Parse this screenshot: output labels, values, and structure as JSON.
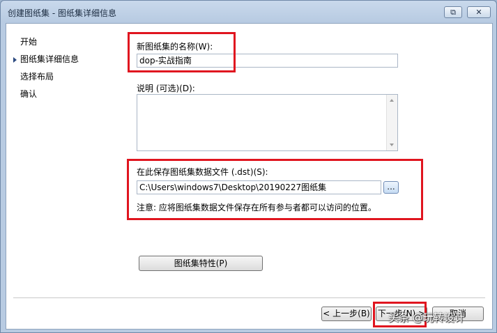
{
  "window": {
    "title": "创建图纸集 - 图纸集详细信息",
    "restore_glyph": "⧉",
    "close_glyph": "✕"
  },
  "steps": [
    {
      "label": "开始",
      "current": false
    },
    {
      "label": "图纸集详细信息",
      "current": true
    },
    {
      "label": "选择布局",
      "current": false
    },
    {
      "label": "确认",
      "current": false
    }
  ],
  "form": {
    "name_label": "新图纸集的名称(W):",
    "name_value": "dop-实战指南",
    "desc_label": "说明 (可选)(D):",
    "desc_value": "",
    "save_label": "在此保存图纸集数据文件 (.dst)(S):",
    "save_value": "C:\\Users\\windows7\\Desktop\\20190227图纸集",
    "browse_label": "...",
    "note": "注意: 应将图纸集数据文件保存在所有参与者都可以访问的位置。",
    "properties_button": "图纸集特性(P)"
  },
  "footer": {
    "back_button": "< 上一步(B)",
    "next_button": "下一步(N) >",
    "cancel_button": "取消"
  },
  "watermark": "头条 @玩转设计",
  "colors": {
    "highlight": "#e0151f",
    "title_bar": "#c9d9ec"
  }
}
